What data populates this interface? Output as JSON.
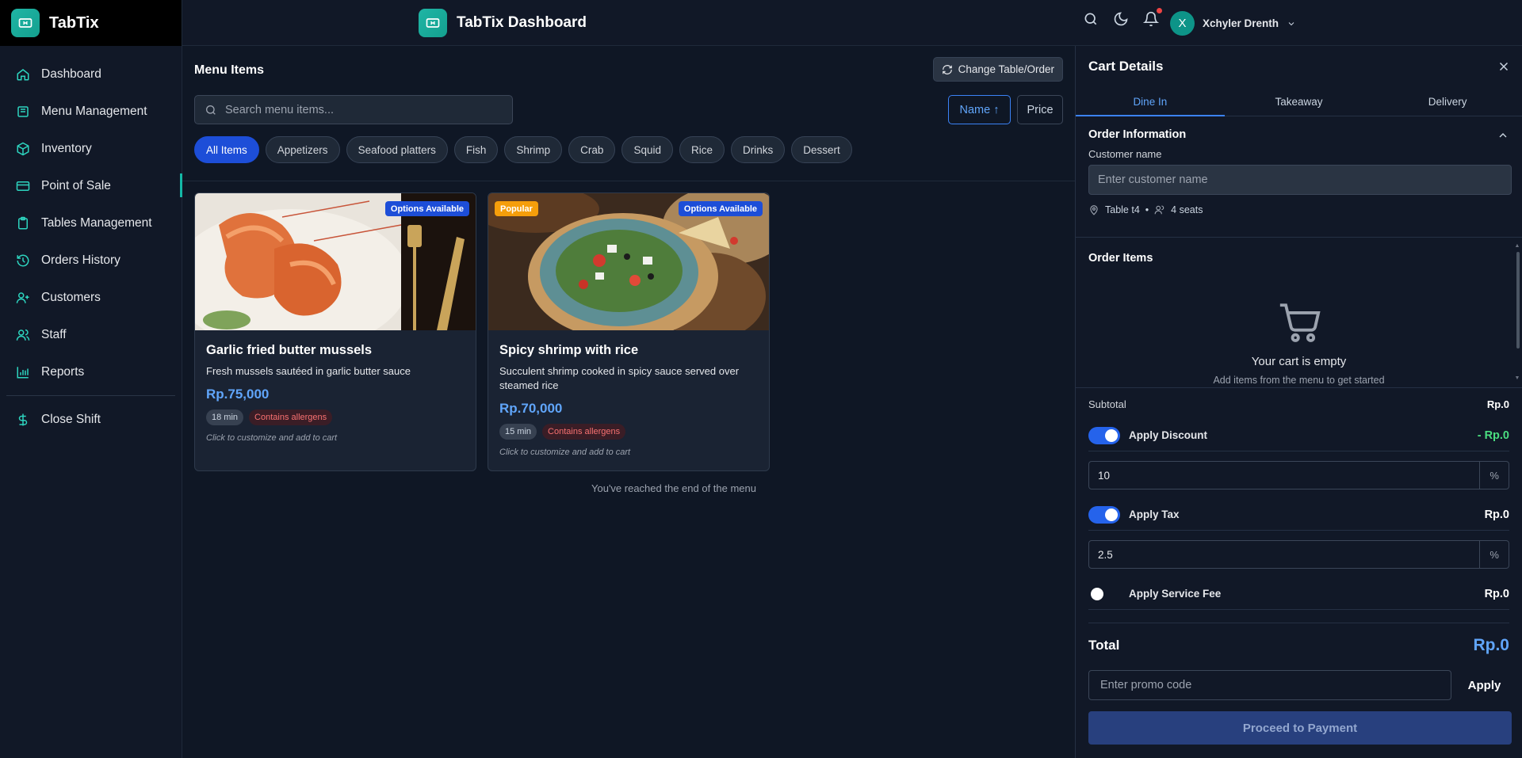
{
  "brand": {
    "name": "TabTix"
  },
  "header": {
    "title": "TabTix Dashboard",
    "user_initial": "X",
    "user_name": "Xchyler Drenth"
  },
  "sidebar": {
    "items": [
      {
        "label": "Dashboard",
        "icon": "home-icon"
      },
      {
        "label": "Menu Management",
        "icon": "menu-book-icon"
      },
      {
        "label": "Inventory",
        "icon": "box-icon"
      },
      {
        "label": "Point of Sale",
        "icon": "credit-card-icon",
        "active": true
      },
      {
        "label": "Tables Management",
        "icon": "clipboard-icon"
      },
      {
        "label": "Orders History",
        "icon": "history-icon"
      },
      {
        "label": "Customers",
        "icon": "user-add-icon"
      },
      {
        "label": "Staff",
        "icon": "users-icon"
      },
      {
        "label": "Reports",
        "icon": "bar-chart-icon"
      }
    ],
    "footer_item": {
      "label": "Close Shift",
      "icon": "dollar-icon"
    }
  },
  "main": {
    "title": "Menu Items",
    "change_button": "Change Table/Order",
    "search_placeholder": "Search menu items...",
    "sort_name": "Name ↑",
    "sort_price": "Price",
    "categories": [
      "All Items",
      "Appetizers",
      "Seafood platters",
      "Fish",
      "Shrimp",
      "Crab",
      "Squid",
      "Rice",
      "Drinks",
      "Dessert"
    ],
    "active_category": "All Items",
    "cards": [
      {
        "title": "Garlic fried butter mussels",
        "description": "Fresh mussels sautéed in garlic butter sauce",
        "price": "Rp.75,000",
        "time": "18 min",
        "allergen": "Contains allergens",
        "hint": "Click to customize and add to cart",
        "badge_options": "Options Available"
      },
      {
        "title": "Spicy shrimp with rice",
        "description": "Succulent shrimp cooked in spicy sauce served over steamed rice",
        "price": "Rp.70,000",
        "time": "15 min",
        "allergen": "Contains allergens",
        "hint": "Click to customize and add to cart",
        "badge_popular": "Popular",
        "badge_options": "Options Available"
      }
    ],
    "end_message": "You've reached the end of the menu"
  },
  "cart": {
    "title": "Cart Details",
    "tabs": [
      "Dine In",
      "Takeaway",
      "Delivery"
    ],
    "active_tab": "Dine In",
    "order_info_title": "Order Information",
    "customer_label": "Customer name",
    "customer_placeholder": "Enter customer name",
    "table": "Table t4",
    "seats": "4 seats",
    "order_items_title": "Order Items",
    "empty_title": "Your cart is empty",
    "empty_sub": "Add items from the menu to get started",
    "subtotal_label": "Subtotal",
    "subtotal_value": "Rp.0",
    "discount_label": "Apply Discount",
    "discount_value": "- Rp.0",
    "discount_pct": "10",
    "tax_label": "Apply Tax",
    "tax_value": "Rp.0",
    "tax_pct": "2.5",
    "percent_suffix": "%",
    "service_label": "Apply Service Fee",
    "service_value": "Rp.0",
    "total_label": "Total",
    "total_value": "Rp.0",
    "promo_placeholder": "Enter promo code",
    "apply_label": "Apply",
    "pay_label": "Proceed to Payment"
  },
  "colors": {
    "accent_teal": "#14b8a6",
    "accent_blue": "#3b82f6",
    "background": "#0f1725",
    "panel": "#111827"
  }
}
